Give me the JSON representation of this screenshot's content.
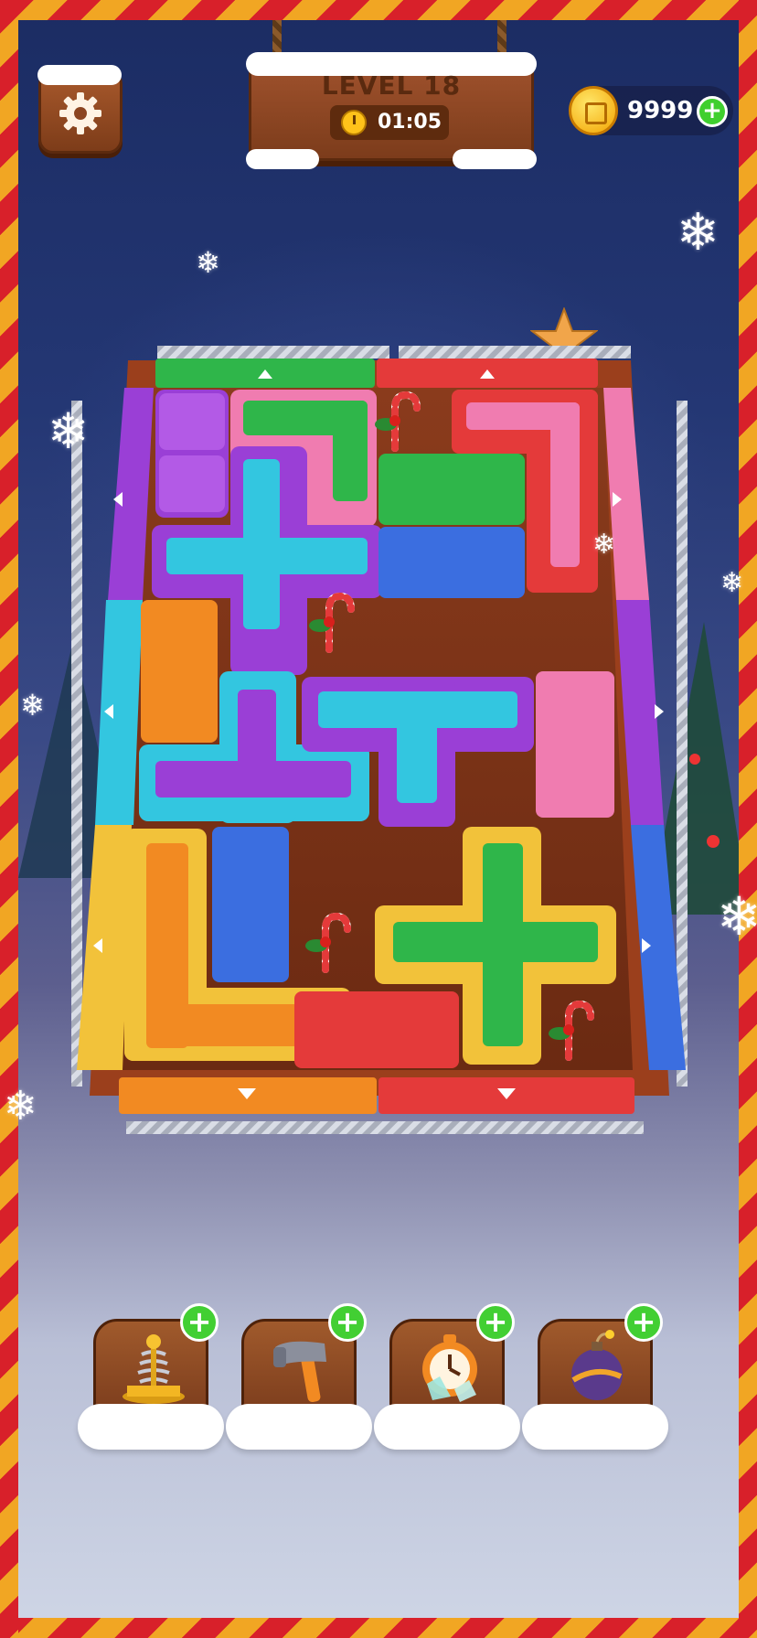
{
  "header": {
    "level_label": "LEVEL 18",
    "timer": "01:05"
  },
  "coins": {
    "amount": "9999"
  },
  "board": {
    "exits": {
      "top": [
        "green",
        "red"
      ],
      "bottom": [
        "orange",
        "red"
      ],
      "left": [
        "purple",
        "cyan",
        "yellow"
      ],
      "right": [
        "pink",
        "purple",
        "blue"
      ]
    },
    "colors": {
      "green": "#2fb64a",
      "red": "#e43a3a",
      "orange": "#f28a22",
      "purple": "#9a3fd6",
      "cyan": "#33c6e0",
      "yellow": "#f2c23a",
      "pink": "#f07cb0",
      "blue": "#3b6ee0",
      "floor": "#7a3519"
    }
  },
  "powerups": [
    {
      "name": "spring",
      "icon": "spring-icon"
    },
    {
      "name": "hammer",
      "icon": "hammer-icon"
    },
    {
      "name": "freeze-clock",
      "icon": "freeze-clock-icon"
    },
    {
      "name": "bomb",
      "icon": "bomb-icon"
    }
  ],
  "decorations": {
    "candy_canes": 4
  }
}
